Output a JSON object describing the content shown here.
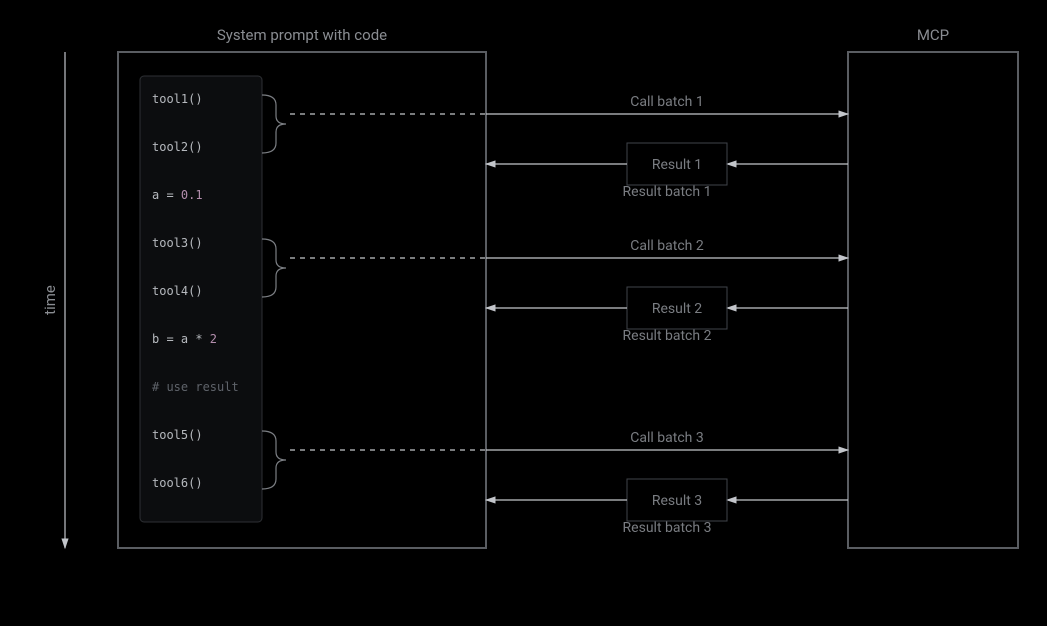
{
  "timeAxis": "time",
  "leftBox": {
    "title": "System prompt with code",
    "code": [
      {
        "type": "call",
        "text": "tool1()"
      },
      {
        "type": "call",
        "text": "tool2()"
      },
      {
        "type": "code",
        "text": "a = 0.1"
      },
      {
        "type": "call",
        "text": "tool3()"
      },
      {
        "type": "call",
        "text": "tool4()"
      },
      {
        "type": "code",
        "text": "b = a * 2 "
      },
      {
        "type": "comment",
        "text": "# use result"
      },
      {
        "type": "call",
        "text": "tool5()"
      },
      {
        "type": "call",
        "text": "tool6()"
      }
    ]
  },
  "rightBox": {
    "title": "MCP"
  },
  "lanes": [
    {
      "top": "Call batch 1",
      "box": "Result 1",
      "bottom": "Result batch 1"
    },
    {
      "top": "Call batch 2",
      "box": "Result 2",
      "bottom": "Result batch 2"
    },
    {
      "top": "Call batch 3",
      "box": "Result 3",
      "bottom": "Result batch 3"
    }
  ]
}
